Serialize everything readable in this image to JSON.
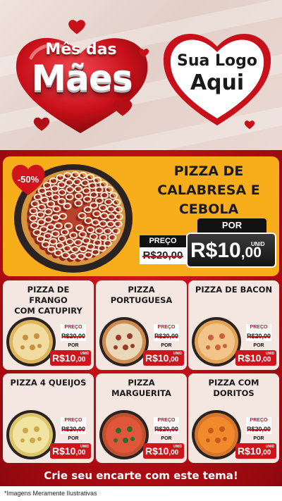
{
  "header": {
    "campaign_line1": "Mês das",
    "campaign_line2": "Mães",
    "logo_line1": "Sua Logo",
    "logo_line2": "Aqui"
  },
  "featured": {
    "discount": "-50%",
    "name_lines": [
      "PIZZA DE",
      "CALABRESA E",
      "CEBOLA"
    ],
    "price_label": "PREÇO",
    "old_price": "R$20,00",
    "por_label": "POR",
    "unit_label": "UNID",
    "new_price_main": "R$10",
    "new_price_cents": ",00"
  },
  "cards": [
    {
      "name_lines": [
        "PIZZA DE FRANGO",
        "COM CATUPIRY"
      ],
      "price_label": "PREÇO",
      "old_price": "R$20,00",
      "por_label": "POR",
      "unit_label": "UNID",
      "new_price_main": "R$10",
      "new_price_cents": ",00"
    },
    {
      "name_lines": [
        "PIZZA",
        "PORTUGUESA"
      ],
      "price_label": "PREÇO",
      "old_price": "R$20,00",
      "por_label": "POR",
      "unit_label": "UNID",
      "new_price_main": "R$10",
      "new_price_cents": ",00"
    },
    {
      "name_lines": [
        "PIZZA DE BACON"
      ],
      "price_label": "PREÇO",
      "old_price": "R$20,00",
      "por_label": "POR",
      "unit_label": "UNID",
      "new_price_main": "R$10",
      "new_price_cents": ",00"
    },
    {
      "name_lines": [
        "PIZZA 4 QUEIJOS"
      ],
      "price_label": "PREÇO",
      "old_price": "R$20,00",
      "por_label": "POR",
      "unit_label": "UNID",
      "new_price_main": "R$10",
      "new_price_cents": ",00"
    },
    {
      "name_lines": [
        "PIZZA",
        "MARGUERITA"
      ],
      "price_label": "PREÇO",
      "old_price": "R$20,00",
      "por_label": "POR",
      "unit_label": "UNID",
      "new_price_main": "R$10",
      "new_price_cents": ",00"
    },
    {
      "name_lines": [
        "PIZZA COM",
        "DORITOS"
      ],
      "price_label": "PREÇO",
      "old_price": "R$20,00",
      "por_label": "POR",
      "unit_label": "UNID",
      "new_price_main": "R$10",
      "new_price_cents": ",00"
    }
  ],
  "call_to_action": "Crie seu encarte com este tema!",
  "disclaimer": "*Imagens Meramente Ilustrativas",
  "colors": {
    "brand_red": "#c8101a",
    "featured_yellow": "#f8ad1a",
    "card_bg": "#f4e7e1",
    "price_black": "#111111"
  }
}
